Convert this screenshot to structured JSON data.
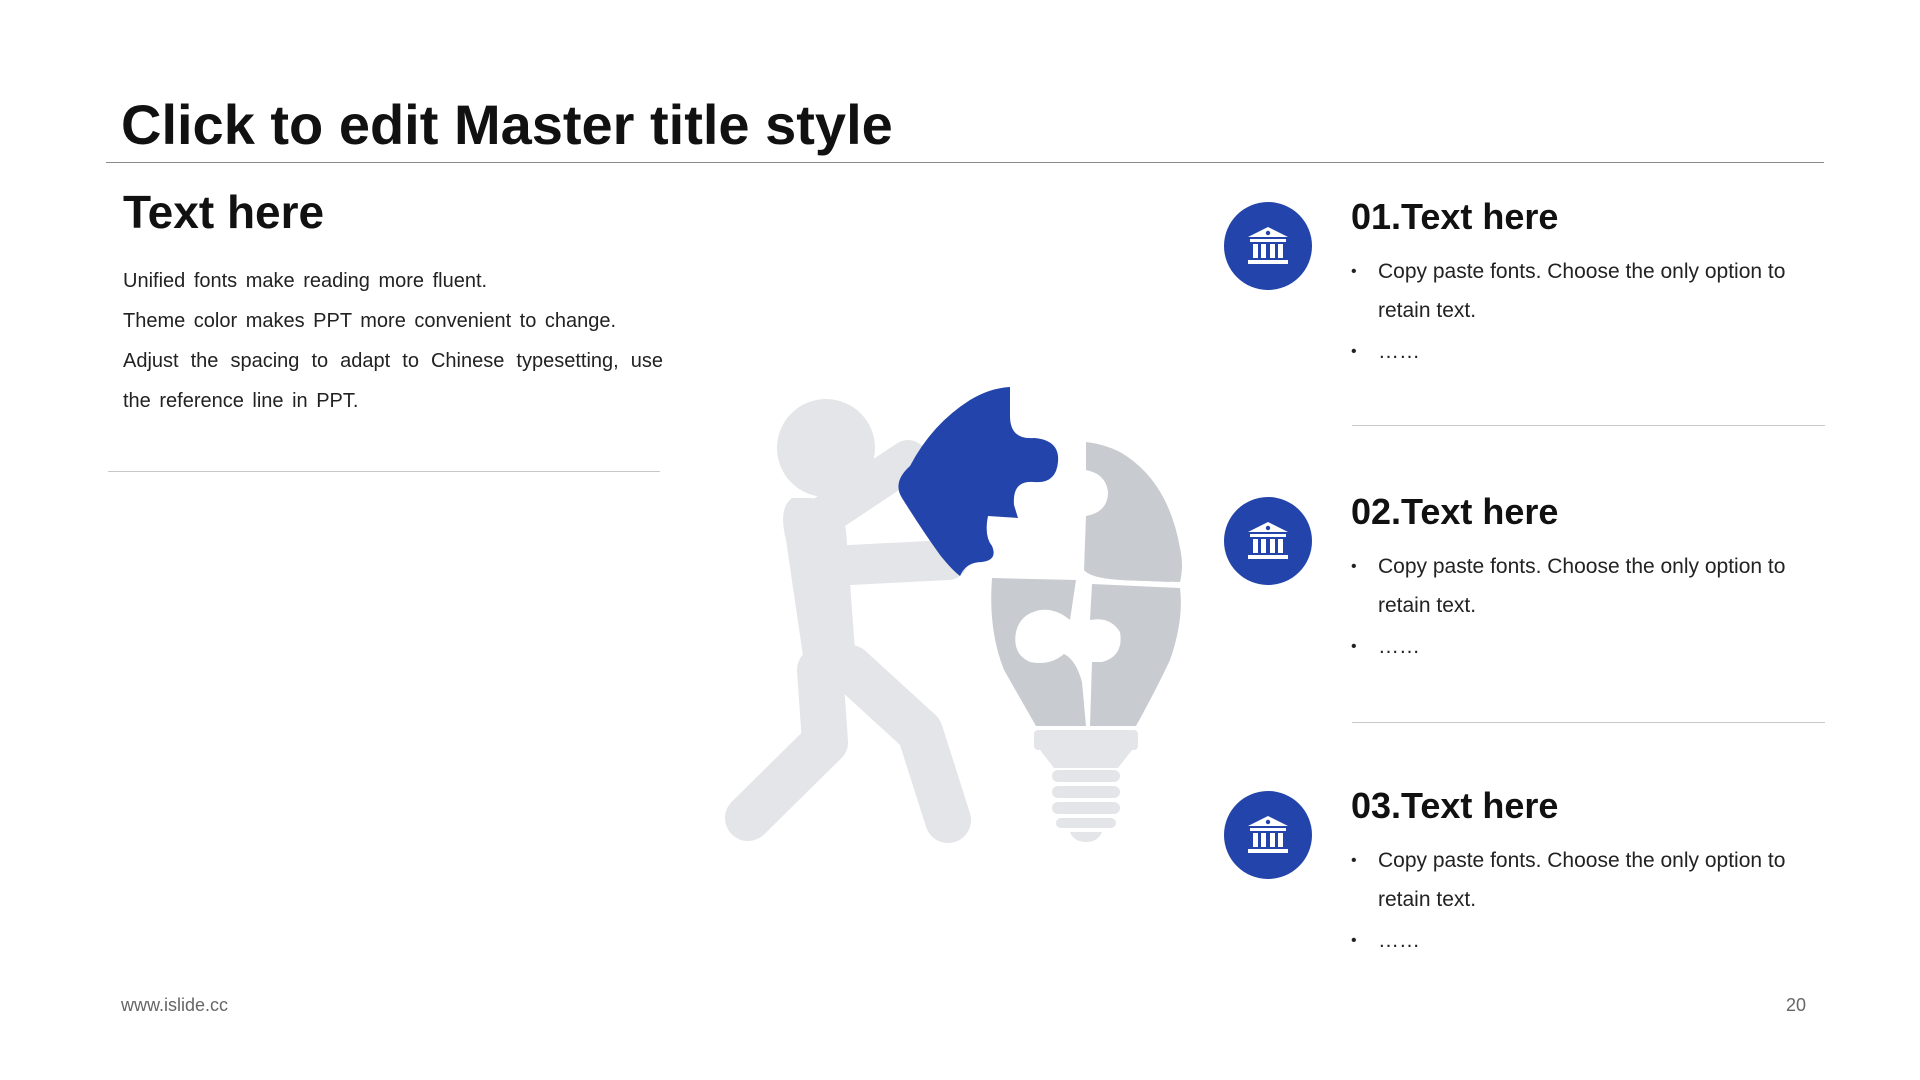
{
  "slide": {
    "title": "Click to edit Master title style",
    "footer_url": "www.islide.cc",
    "page_number": "20"
  },
  "left": {
    "heading": "Text here",
    "lines": [
      "Unified fonts make reading more fluent.",
      "Theme color makes PPT more convenient to change.",
      "Adjust the spacing to adapt to Chinese typesetting, use the reference line in PPT."
    ]
  },
  "items": [
    {
      "title": "01.Text here",
      "icon": "bank-icon",
      "bullets": [
        "Copy paste fonts. Choose the only option to retain text.",
        "……"
      ]
    },
    {
      "title": "02.Text here",
      "icon": "bank-icon",
      "bullets": [
        "Copy paste fonts. Choose the only option to retain text.",
        "……"
      ]
    },
    {
      "title": "03.Text here",
      "icon": "bank-icon",
      "bullets": [
        "Copy paste fonts. Choose the only option to retain text.",
        "……"
      ]
    }
  ],
  "colors": {
    "accent": "#2344aa",
    "figure_light": "#e4e5e8",
    "puzzle_gray": "#c8cbd0",
    "text": "#111111",
    "muted": "#666666",
    "rule": "#c8c8c8"
  }
}
